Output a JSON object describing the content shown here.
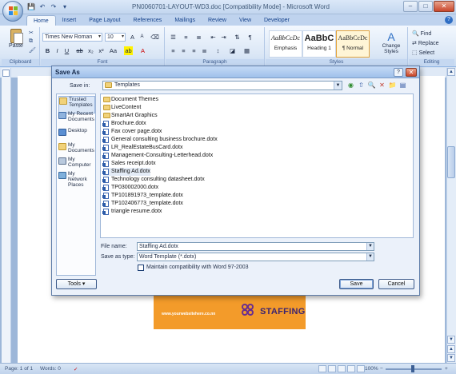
{
  "window": {
    "title": "PN0060701-LAYOUT-WD3.doc [Compatibility Mode] - Microsoft Word",
    "controls": [
      "–",
      "□",
      "✕"
    ]
  },
  "qat": {
    "save": "💾",
    "undo": "↶",
    "redo": "↷",
    "more": "▾"
  },
  "ribbon": {
    "tabs": [
      "Home",
      "Insert",
      "Page Layout",
      "References",
      "Mailings",
      "Review",
      "View",
      "Developer"
    ],
    "active_tab": "Home",
    "clipboard": {
      "paste_label": "Paste",
      "group_label": "Clipboard"
    },
    "font": {
      "name": "Times New Roman",
      "size": "10",
      "group_label": "Font"
    },
    "paragraph": {
      "group_label": "Paragraph"
    },
    "styles": {
      "items": [
        {
          "sample": "AaBbCcDc",
          "name": "Emphasis"
        },
        {
          "sample": "AaBbC",
          "name": "Heading 1"
        },
        {
          "sample": "AaBbCcDc",
          "name": "¶ Normal"
        }
      ],
      "change_styles": "Change Styles",
      "group_label": "Styles"
    },
    "editing": {
      "find": "Find",
      "replace": "Replace",
      "select": "Select",
      "group_label": "Editing"
    }
  },
  "dialog": {
    "title": "Save As",
    "save_in_label": "Save in:",
    "save_in_value": "Templates",
    "places": [
      "Trusted Templates",
      "My Recent Documents",
      "Desktop",
      "My Documents",
      "My Computer",
      "My Network Places"
    ],
    "files": [
      {
        "name": "Document Themes",
        "type": "folder"
      },
      {
        "name": "LiveContent",
        "type": "folder"
      },
      {
        "name": "SmartArt Graphics",
        "type": "folder"
      },
      {
        "name": "Brochure.dotx",
        "type": "doc"
      },
      {
        "name": "Fax cover page.dotx",
        "type": "doc"
      },
      {
        "name": "General consulting business brochure.dotx",
        "type": "doc"
      },
      {
        "name": "LR_RealEstateBusCard.dotx",
        "type": "doc"
      },
      {
        "name": "Management-Consulting-Letterhead.dotx",
        "type": "doc"
      },
      {
        "name": "Sales receipt.dotx",
        "type": "doc"
      },
      {
        "name": "Staffing Ad.dotx",
        "type": "doc",
        "selected": true
      },
      {
        "name": "Technology consulting datasheet.dotx",
        "type": "doc"
      },
      {
        "name": "TP030002000.dotx",
        "type": "doc"
      },
      {
        "name": "TP101891973_template.dotx",
        "type": "doc"
      },
      {
        "name": "TP102406773_template.dotx",
        "type": "doc"
      },
      {
        "name": "triangle resume.dotx",
        "type": "doc"
      }
    ],
    "file_name_label": "File name:",
    "file_name_value": "Staffing Ad.dotx",
    "save_as_type_label": "Save as type:",
    "save_as_type_value": "Word Template (*.dotx)",
    "compat_label": "Maintain compatibility with Word 97-2003",
    "tools_label": "Tools",
    "save_label": "Save",
    "cancel_label": "Cancel"
  },
  "document": {
    "banner_url": "www.yourwebsitehere.co.nn",
    "banner_title": "STAFFING",
    "banner_color": "#f39b2a"
  },
  "status": {
    "page": "Page: 1 of 1",
    "words": "Words: 0",
    "zoom": "100%"
  }
}
